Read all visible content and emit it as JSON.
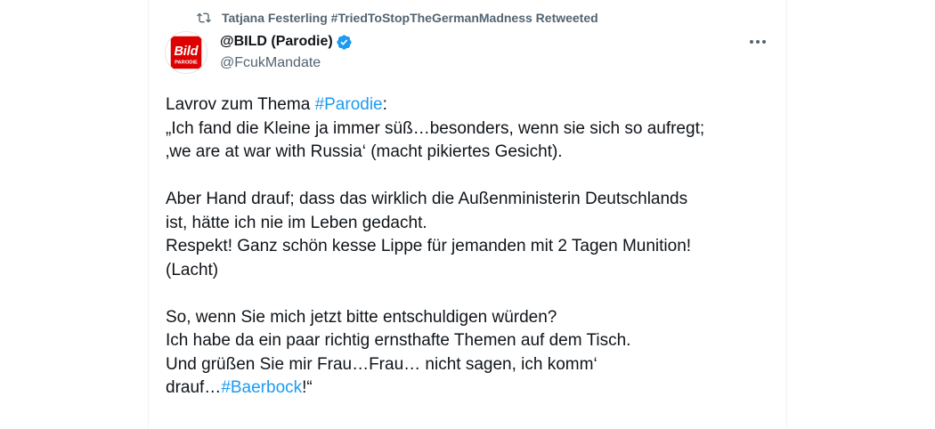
{
  "retweet": {
    "text": "Tatjana Festerling #TriedToStopTheGermanMadness Retweeted",
    "icon": "retweet-icon"
  },
  "author": {
    "display_name": "@BILD (Parodie)",
    "handle": "@FcukMandate",
    "verified": true,
    "avatar_text": "Bild",
    "avatar_subtext": "PARODIE"
  },
  "more_icon": "more-horizontal-icon",
  "tweet": {
    "line1_prefix": "Lavrov zum Thema ",
    "line1_hashtag": "#Parodie",
    "line1_suffix": ":",
    "line2": "„Ich fand die Kleine ja immer süß…besonders, wenn sie sich so aufregt;",
    "line3": "‚we are at war with Russia‘ (macht pikiertes Gesicht).",
    "line4": "Aber Hand drauf; dass das wirklich die Außenministerin Deutschlands",
    "line5": "ist, hätte ich nie im Leben gedacht.",
    "line6": "Respekt! Ganz schön kesse Lippe für jemanden mit 2 Tagen Munition!",
    "line7": "(Lacht)",
    "line8": "So, wenn Sie mich jetzt bitte entschuldigen würden?",
    "line9": "Ich habe da ein paar richtig ernsthafte Themen auf dem Tisch.",
    "line10": "Und grüßen Sie mir Frau…Frau… nicht sagen, ich komm‘",
    "line11_prefix": "drauf…",
    "line11_hashtag": "#Baerbock",
    "line11_suffix": "!“"
  },
  "colors": {
    "link": "#1d9bf0",
    "secondary_text": "#536471",
    "bild_red": "#dd0000",
    "verified_blue": "#1d9bf0"
  }
}
